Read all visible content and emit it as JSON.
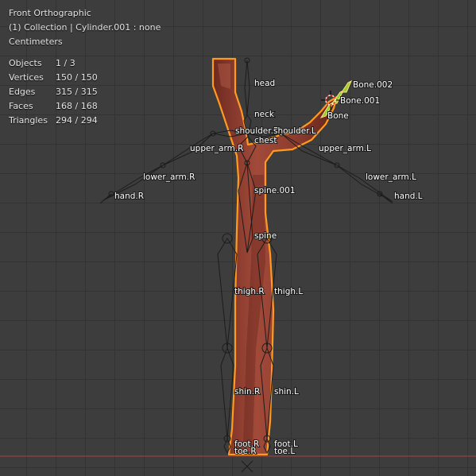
{
  "viewport": {
    "view_name": "Front Orthographic",
    "collection_line": "(1) Collection | Cylinder.001 : none",
    "units": "Centimeters"
  },
  "stats": [
    {
      "label": "Objects",
      "value": "1 / 3"
    },
    {
      "label": "Vertices",
      "value": "150 / 150"
    },
    {
      "label": "Edges",
      "value": "315 / 315"
    },
    {
      "label": "Faces",
      "value": "168 / 168"
    },
    {
      "label": "Triangles",
      "value": "294 / 294"
    }
  ],
  "bones": {
    "head": "head",
    "neck": "neck",
    "chest": "chest",
    "shoulder_r": "shoulder.R",
    "shoulder_l": "shoulder.L",
    "upper_arm_r": "upper_arm.R",
    "upper_arm_l": "upper_arm.L",
    "lower_arm_r": "lower_arm.R",
    "lower_arm_l": "lower_arm.L",
    "hand_r": "hand.R",
    "hand_l": "hand.L",
    "spine_001": "spine.001",
    "spine": "spine",
    "thigh_r": "thigh.R",
    "thigh_l": "thigh.L",
    "shin_r": "shin.R",
    "shin_l": "shin.L",
    "foot_r": "foot.R",
    "foot_l": "foot.L",
    "toe_r": "toe.R",
    "toe_l": "toe.L",
    "bone": "Bone",
    "bone_001": "Bone.001",
    "bone_002": "Bone.002"
  },
  "colors": {
    "background": "#3d3d3d",
    "grid": "#333333",
    "mesh_fill": "#8a3a2c",
    "selection_outline": "#ff9a1f",
    "armature": "#1c1c1c",
    "ground_line": "#a84444",
    "active_bone": "#9acd32"
  }
}
